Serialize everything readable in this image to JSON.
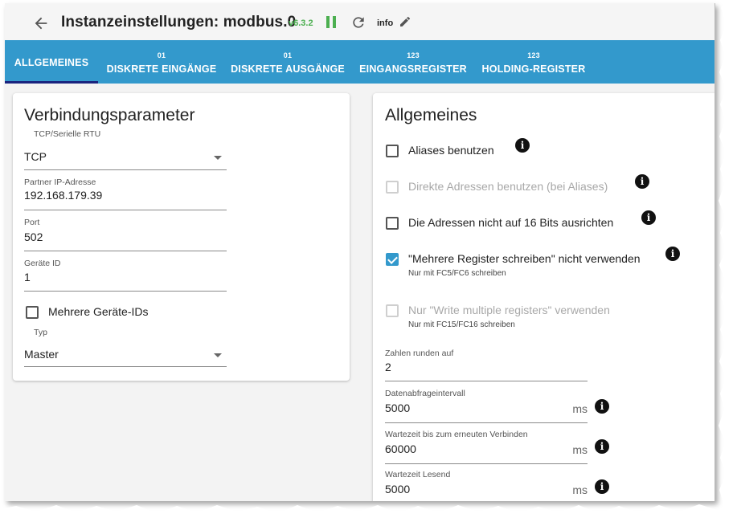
{
  "header": {
    "title": "Instanzeinstellungen: modbus.0",
    "version": "v6.3.2",
    "info_label": "info"
  },
  "tabs": [
    {
      "label": "ALLGEMEINES",
      "icon_text": ""
    },
    {
      "label": "DISKRETE EINGÄNGE",
      "icon_text": "01"
    },
    {
      "label": "DISKRETE AUSGÄNGE",
      "icon_text": "01"
    },
    {
      "label": "EINGANGSREGISTER",
      "icon_text": "123"
    },
    {
      "label": "HOLDING-REGISTER",
      "icon_text": "123"
    }
  ],
  "left": {
    "heading": "Verbindungsparameter",
    "connection_type": {
      "label": "TCP/Serielle RTU",
      "value": "TCP"
    },
    "partner_ip": {
      "label": "Partner IP-Adresse",
      "value": "192.168.179.39"
    },
    "port": {
      "label": "Port",
      "value": "502"
    },
    "device_id": {
      "label": "Geräte ID",
      "value": "1"
    },
    "multi_device_ids": {
      "label": "Mehrere Geräte-IDs",
      "checked": false
    },
    "type": {
      "label": "Typ",
      "value": "Master"
    }
  },
  "right": {
    "heading": "Allgemeines",
    "checkboxes": [
      {
        "label": "Aliases benutzen",
        "checked": false,
        "disabled": false,
        "sub": ""
      },
      {
        "label": "Direkte Adressen benutzen (bei Aliases)",
        "checked": false,
        "disabled": true,
        "sub": ""
      },
      {
        "label": "Die Adressen nicht auf 16 Bits ausrichten",
        "checked": false,
        "disabled": false,
        "sub": ""
      },
      {
        "label": "\"Mehrere Register schreiben\" nicht verwenden",
        "checked": true,
        "disabled": false,
        "sub": "Nur mit FC5/FC6 schreiben"
      },
      {
        "label": "Nur \"Write multiple registers\" verwenden",
        "checked": false,
        "disabled": true,
        "sub": "Nur mit FC15/FC16 schreiben"
      }
    ],
    "round": {
      "label": "Zahlen runden auf",
      "value": "2"
    },
    "poll": {
      "label": "Datenabfrageintervall",
      "value": "5000",
      "unit": "ms"
    },
    "reconnect": {
      "label": "Wartezeit bis zum erneuten Verbinden",
      "value": "60000",
      "unit": "ms"
    },
    "read_timeout": {
      "label": "Wartezeit Lesend",
      "value": "5000",
      "unit": "ms"
    }
  },
  "colors": {
    "accent": "#3399cc",
    "version_green": "#4caf50"
  }
}
